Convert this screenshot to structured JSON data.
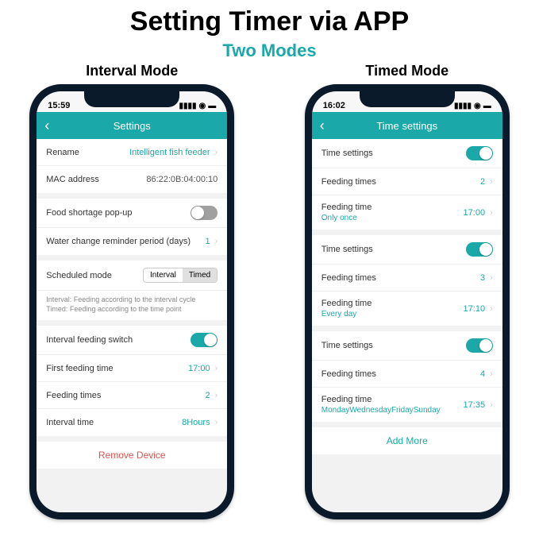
{
  "title": "Setting Timer via APP",
  "subtitle": "Two Modes",
  "mode_labels": {
    "interval": "Interval Mode",
    "timed": "Timed Mode"
  },
  "phone1": {
    "time": "15:59",
    "header": "Settings",
    "rows": {
      "rename_label": "Rename",
      "rename_value": "Intelligent fish feeder",
      "mac_label": "MAC address",
      "mac_value": "86:22:0B:04:00:10",
      "food_label": "Food shortage pop-up",
      "water_label": "Water change reminder period (days)",
      "water_value": "1",
      "sched_label": "Scheduled mode",
      "seg_interval": "Interval",
      "seg_timed": "Timed",
      "note1": "Interval: Feeding according to the interval cycle",
      "note2": "Timed: Feeding according to the time point",
      "switch_label": "Interval feeding switch",
      "first_label": "First feeding time",
      "first_val": "17:00",
      "times_label": "Feeding times",
      "times_val": "2",
      "ivtime_label": "Interval time",
      "ivtime_val": "8Hours",
      "remove": "Remove Device"
    }
  },
  "phone2": {
    "time": "16:02",
    "header": "Time settings",
    "blocks": [
      {
        "ts_label": "Time settings",
        "ft_label": "Feeding times",
        "ft_val": "2",
        "time_label": "Feeding time",
        "time_val": "17:00",
        "repeat": "Only once"
      },
      {
        "ts_label": "Time settings",
        "ft_label": "Feeding times",
        "ft_val": "3",
        "time_label": "Feeding time",
        "time_val": "17:10",
        "repeat": "Every day"
      },
      {
        "ts_label": "Time settings",
        "ft_label": "Feeding times",
        "ft_val": "4",
        "time_label": "Feeding time",
        "time_val": "17:35",
        "repeat": "MondayWednesdayFridaySunday"
      }
    ],
    "addmore": "Add More"
  }
}
